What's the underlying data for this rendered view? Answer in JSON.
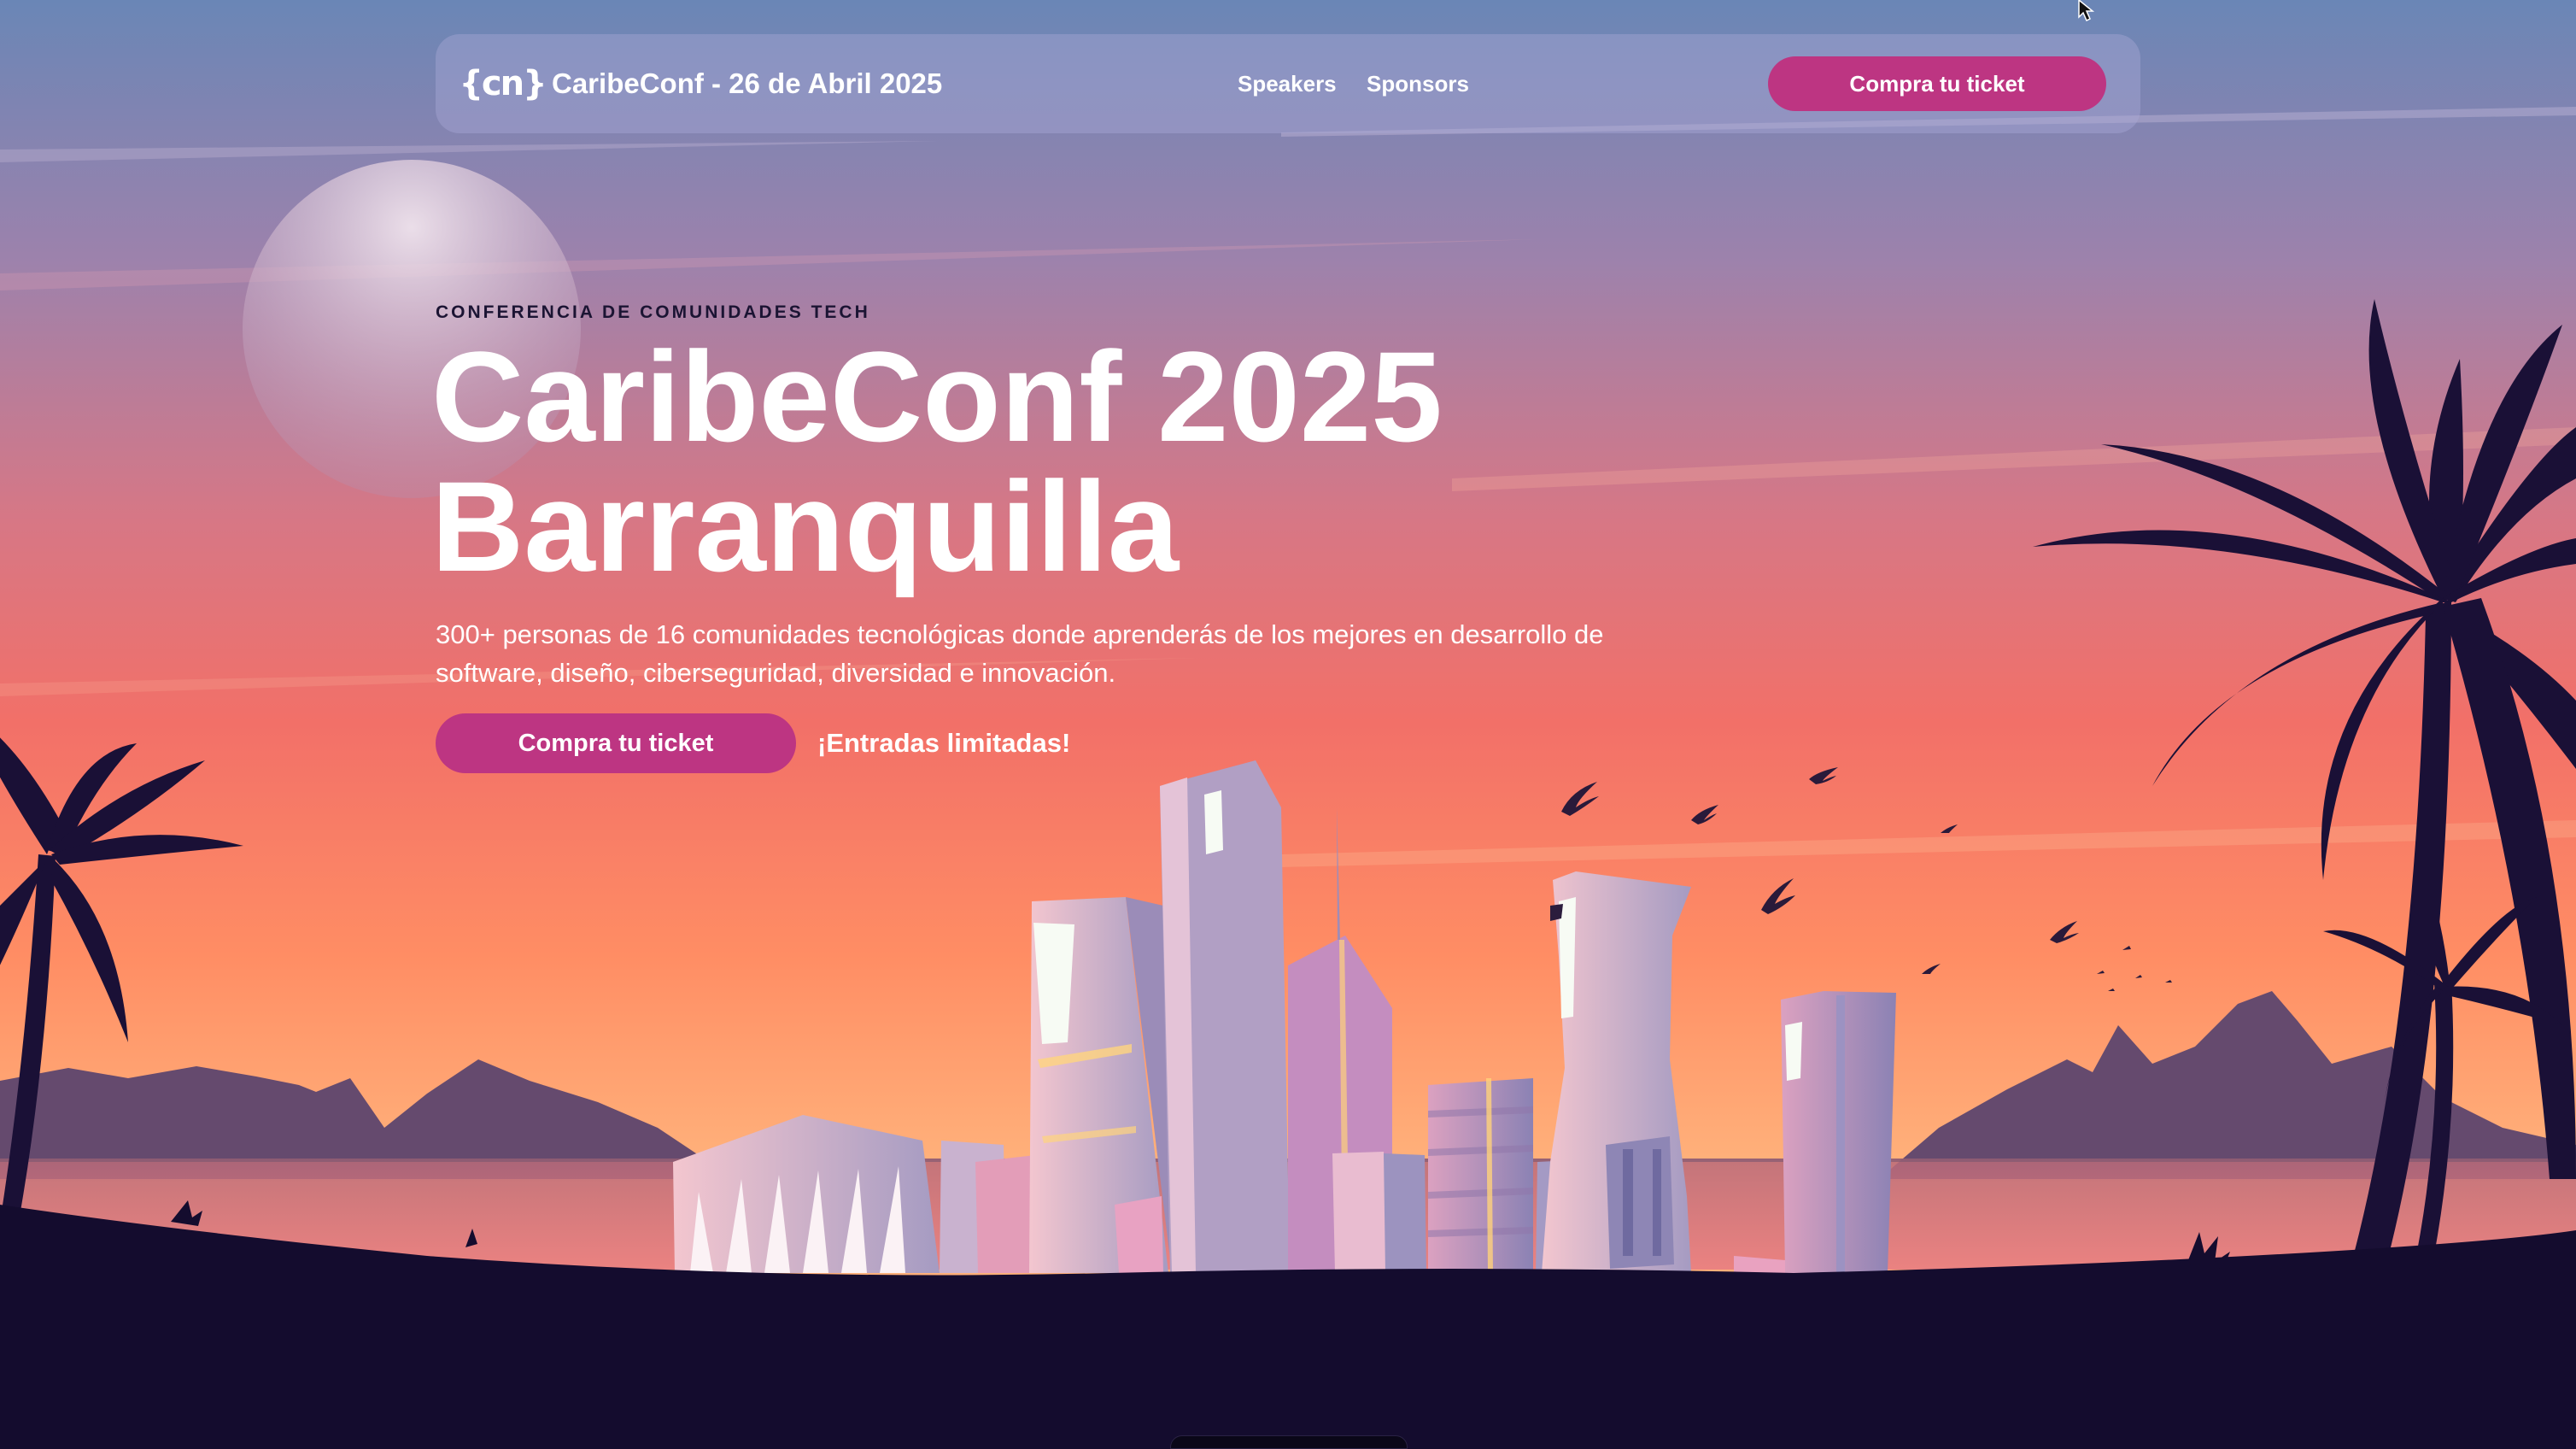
{
  "nav": {
    "logo_text": "{cn}",
    "brand_text": "CaribeConf - 26 de Abril 2025",
    "links": [
      {
        "label": "Speakers"
      },
      {
        "label": "Sponsors"
      }
    ],
    "cta_label": "Compra tu ticket"
  },
  "hero": {
    "eyebrow": "CONFERENCIA DE COMUNIDADES TECH",
    "title_line1": "CaribeConf 2025",
    "title_line2": "Barranquilla",
    "description": "300+ personas de 16 comunidades tecnológicas donde aprenderás de los mejores en desarrollo de software, diseño, ciberseguridad, diversidad e innovación.",
    "cta_label": "Compra tu ticket",
    "limited_text": "¡Entradas limitadas!"
  },
  "theme": {
    "accent": "#bd3582",
    "ground": "#140c2e",
    "palm": "#1a1036",
    "sky_top": "#6b86b8",
    "sky_mid": "#e6727c",
    "sky_low": "#ff9d6c"
  },
  "icons": {
    "logo": "caribeconf-logo-icon",
    "cursor": "mouse-pointer-icon"
  }
}
